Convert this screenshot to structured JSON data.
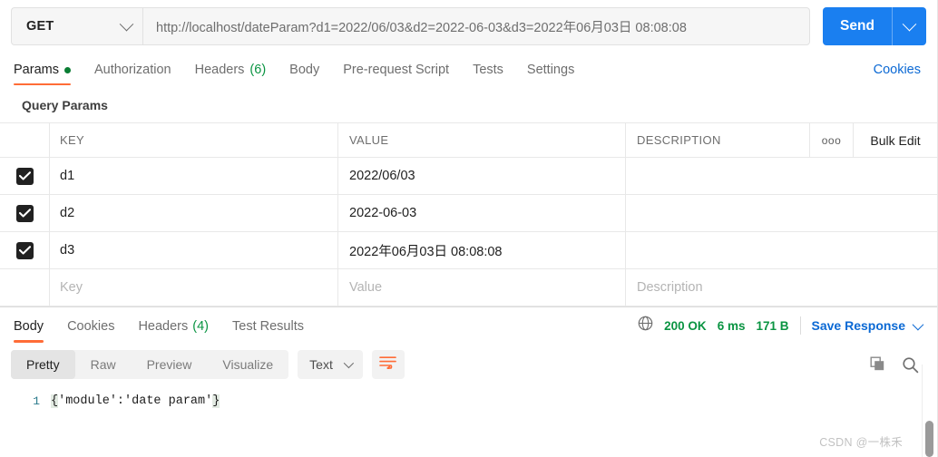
{
  "request": {
    "method": "GET",
    "url": "http://localhost/dateParam?d1=2022/06/03&d2=2022-06-03&d3=2022年06月03日 08:08:08",
    "send_label": "Send",
    "method_caret_icon": "chevron-down-icon",
    "send_caret_icon": "chevron-down-icon"
  },
  "request_tabs": {
    "items": [
      {
        "label": "Params",
        "badge": "",
        "has_dot": true,
        "active": true
      },
      {
        "label": "Authorization",
        "badge": "",
        "has_dot": false,
        "active": false
      },
      {
        "label": "Headers",
        "badge": "(6)",
        "has_dot": false,
        "active": false
      },
      {
        "label": "Body",
        "badge": "",
        "has_dot": false,
        "active": false
      },
      {
        "label": "Pre-request Script",
        "badge": "",
        "has_dot": false,
        "active": false
      },
      {
        "label": "Tests",
        "badge": "",
        "has_dot": false,
        "active": false
      },
      {
        "label": "Settings",
        "badge": "",
        "has_dot": false,
        "active": false
      }
    ],
    "cookies_label": "Cookies"
  },
  "query_params": {
    "section_title": "Query Params",
    "columns": {
      "key": "KEY",
      "value": "VALUE",
      "description": "DESCRIPTION"
    },
    "options_icon": "ooo",
    "bulk_edit_label": "Bulk Edit",
    "rows": [
      {
        "checked": true,
        "key": "d1",
        "value": "2022/06/03",
        "description": ""
      },
      {
        "checked": true,
        "key": "d2",
        "value": "2022-06-03",
        "description": ""
      },
      {
        "checked": true,
        "key": "d3",
        "value": "2022年06月03日 08:08:08",
        "description": ""
      }
    ],
    "empty_row": {
      "key_placeholder": "Key",
      "value_placeholder": "Value",
      "description_placeholder": "Description"
    }
  },
  "response_tabs": {
    "items": [
      {
        "label": "Body",
        "badge": "",
        "active": true
      },
      {
        "label": "Cookies",
        "badge": "",
        "active": false
      },
      {
        "label": "Headers",
        "badge": "(4)",
        "active": false
      },
      {
        "label": "Test Results",
        "badge": "",
        "active": false
      }
    ]
  },
  "response_status": {
    "globe_icon": "globe-icon",
    "status": "200 OK",
    "time": "6 ms",
    "size": "171 B",
    "save_response_label": "Save Response",
    "save_caret_icon": "chevron-down-icon"
  },
  "format_toolbar": {
    "views": [
      {
        "label": "Pretty",
        "active": true
      },
      {
        "label": "Raw",
        "active": false
      },
      {
        "label": "Preview",
        "active": false
      },
      {
        "label": "Visualize",
        "active": false
      }
    ],
    "type_label": "Text",
    "type_caret_icon": "chevron-down-icon",
    "wrap_icon": "word-wrap-icon",
    "copy_icon": "copy-icon",
    "search_icon": "search-icon"
  },
  "response_body": {
    "line_number": "1",
    "open_brace": "{",
    "content": "'module':'date param'",
    "close_brace": "}"
  },
  "watermark": {
    "text": "CSDN @一株禾"
  },
  "colors": {
    "accent_orange": "#ff6c37",
    "send_blue": "#1a7ff0",
    "link_blue": "#0b69d4",
    "status_green": "#0a9442",
    "dot_green": "#0a7d33",
    "checkbox_dark": "#212121"
  }
}
